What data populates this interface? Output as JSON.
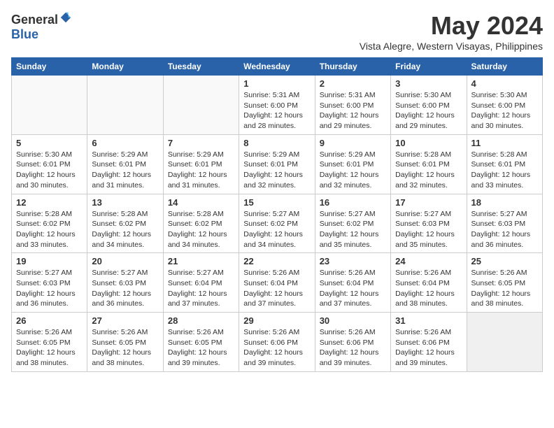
{
  "header": {
    "logo_general": "General",
    "logo_blue": "Blue",
    "month_title": "May 2024",
    "location": "Vista Alegre, Western Visayas, Philippines"
  },
  "weekdays": [
    "Sunday",
    "Monday",
    "Tuesday",
    "Wednesday",
    "Thursday",
    "Friday",
    "Saturday"
  ],
  "weeks": [
    [
      {
        "day": "",
        "info": ""
      },
      {
        "day": "",
        "info": ""
      },
      {
        "day": "",
        "info": ""
      },
      {
        "day": "1",
        "info": "Sunrise: 5:31 AM\nSunset: 6:00 PM\nDaylight: 12 hours\nand 28 minutes."
      },
      {
        "day": "2",
        "info": "Sunrise: 5:31 AM\nSunset: 6:00 PM\nDaylight: 12 hours\nand 29 minutes."
      },
      {
        "day": "3",
        "info": "Sunrise: 5:30 AM\nSunset: 6:00 PM\nDaylight: 12 hours\nand 29 minutes."
      },
      {
        "day": "4",
        "info": "Sunrise: 5:30 AM\nSunset: 6:00 PM\nDaylight: 12 hours\nand 30 minutes."
      }
    ],
    [
      {
        "day": "5",
        "info": "Sunrise: 5:30 AM\nSunset: 6:01 PM\nDaylight: 12 hours\nand 30 minutes."
      },
      {
        "day": "6",
        "info": "Sunrise: 5:29 AM\nSunset: 6:01 PM\nDaylight: 12 hours\nand 31 minutes."
      },
      {
        "day": "7",
        "info": "Sunrise: 5:29 AM\nSunset: 6:01 PM\nDaylight: 12 hours\nand 31 minutes."
      },
      {
        "day": "8",
        "info": "Sunrise: 5:29 AM\nSunset: 6:01 PM\nDaylight: 12 hours\nand 32 minutes."
      },
      {
        "day": "9",
        "info": "Sunrise: 5:29 AM\nSunset: 6:01 PM\nDaylight: 12 hours\nand 32 minutes."
      },
      {
        "day": "10",
        "info": "Sunrise: 5:28 AM\nSunset: 6:01 PM\nDaylight: 12 hours\nand 32 minutes."
      },
      {
        "day": "11",
        "info": "Sunrise: 5:28 AM\nSunset: 6:01 PM\nDaylight: 12 hours\nand 33 minutes."
      }
    ],
    [
      {
        "day": "12",
        "info": "Sunrise: 5:28 AM\nSunset: 6:02 PM\nDaylight: 12 hours\nand 33 minutes."
      },
      {
        "day": "13",
        "info": "Sunrise: 5:28 AM\nSunset: 6:02 PM\nDaylight: 12 hours\nand 34 minutes."
      },
      {
        "day": "14",
        "info": "Sunrise: 5:28 AM\nSunset: 6:02 PM\nDaylight: 12 hours\nand 34 minutes."
      },
      {
        "day": "15",
        "info": "Sunrise: 5:27 AM\nSunset: 6:02 PM\nDaylight: 12 hours\nand 34 minutes."
      },
      {
        "day": "16",
        "info": "Sunrise: 5:27 AM\nSunset: 6:02 PM\nDaylight: 12 hours\nand 35 minutes."
      },
      {
        "day": "17",
        "info": "Sunrise: 5:27 AM\nSunset: 6:03 PM\nDaylight: 12 hours\nand 35 minutes."
      },
      {
        "day": "18",
        "info": "Sunrise: 5:27 AM\nSunset: 6:03 PM\nDaylight: 12 hours\nand 36 minutes."
      }
    ],
    [
      {
        "day": "19",
        "info": "Sunrise: 5:27 AM\nSunset: 6:03 PM\nDaylight: 12 hours\nand 36 minutes."
      },
      {
        "day": "20",
        "info": "Sunrise: 5:27 AM\nSunset: 6:03 PM\nDaylight: 12 hours\nand 36 minutes."
      },
      {
        "day": "21",
        "info": "Sunrise: 5:27 AM\nSunset: 6:04 PM\nDaylight: 12 hours\nand 37 minutes."
      },
      {
        "day": "22",
        "info": "Sunrise: 5:26 AM\nSunset: 6:04 PM\nDaylight: 12 hours\nand 37 minutes."
      },
      {
        "day": "23",
        "info": "Sunrise: 5:26 AM\nSunset: 6:04 PM\nDaylight: 12 hours\nand 37 minutes."
      },
      {
        "day": "24",
        "info": "Sunrise: 5:26 AM\nSunset: 6:04 PM\nDaylight: 12 hours\nand 38 minutes."
      },
      {
        "day": "25",
        "info": "Sunrise: 5:26 AM\nSunset: 6:05 PM\nDaylight: 12 hours\nand 38 minutes."
      }
    ],
    [
      {
        "day": "26",
        "info": "Sunrise: 5:26 AM\nSunset: 6:05 PM\nDaylight: 12 hours\nand 38 minutes."
      },
      {
        "day": "27",
        "info": "Sunrise: 5:26 AM\nSunset: 6:05 PM\nDaylight: 12 hours\nand 38 minutes."
      },
      {
        "day": "28",
        "info": "Sunrise: 5:26 AM\nSunset: 6:05 PM\nDaylight: 12 hours\nand 39 minutes."
      },
      {
        "day": "29",
        "info": "Sunrise: 5:26 AM\nSunset: 6:06 PM\nDaylight: 12 hours\nand 39 minutes."
      },
      {
        "day": "30",
        "info": "Sunrise: 5:26 AM\nSunset: 6:06 PM\nDaylight: 12 hours\nand 39 minutes."
      },
      {
        "day": "31",
        "info": "Sunrise: 5:26 AM\nSunset: 6:06 PM\nDaylight: 12 hours\nand 39 minutes."
      },
      {
        "day": "",
        "info": ""
      }
    ]
  ]
}
